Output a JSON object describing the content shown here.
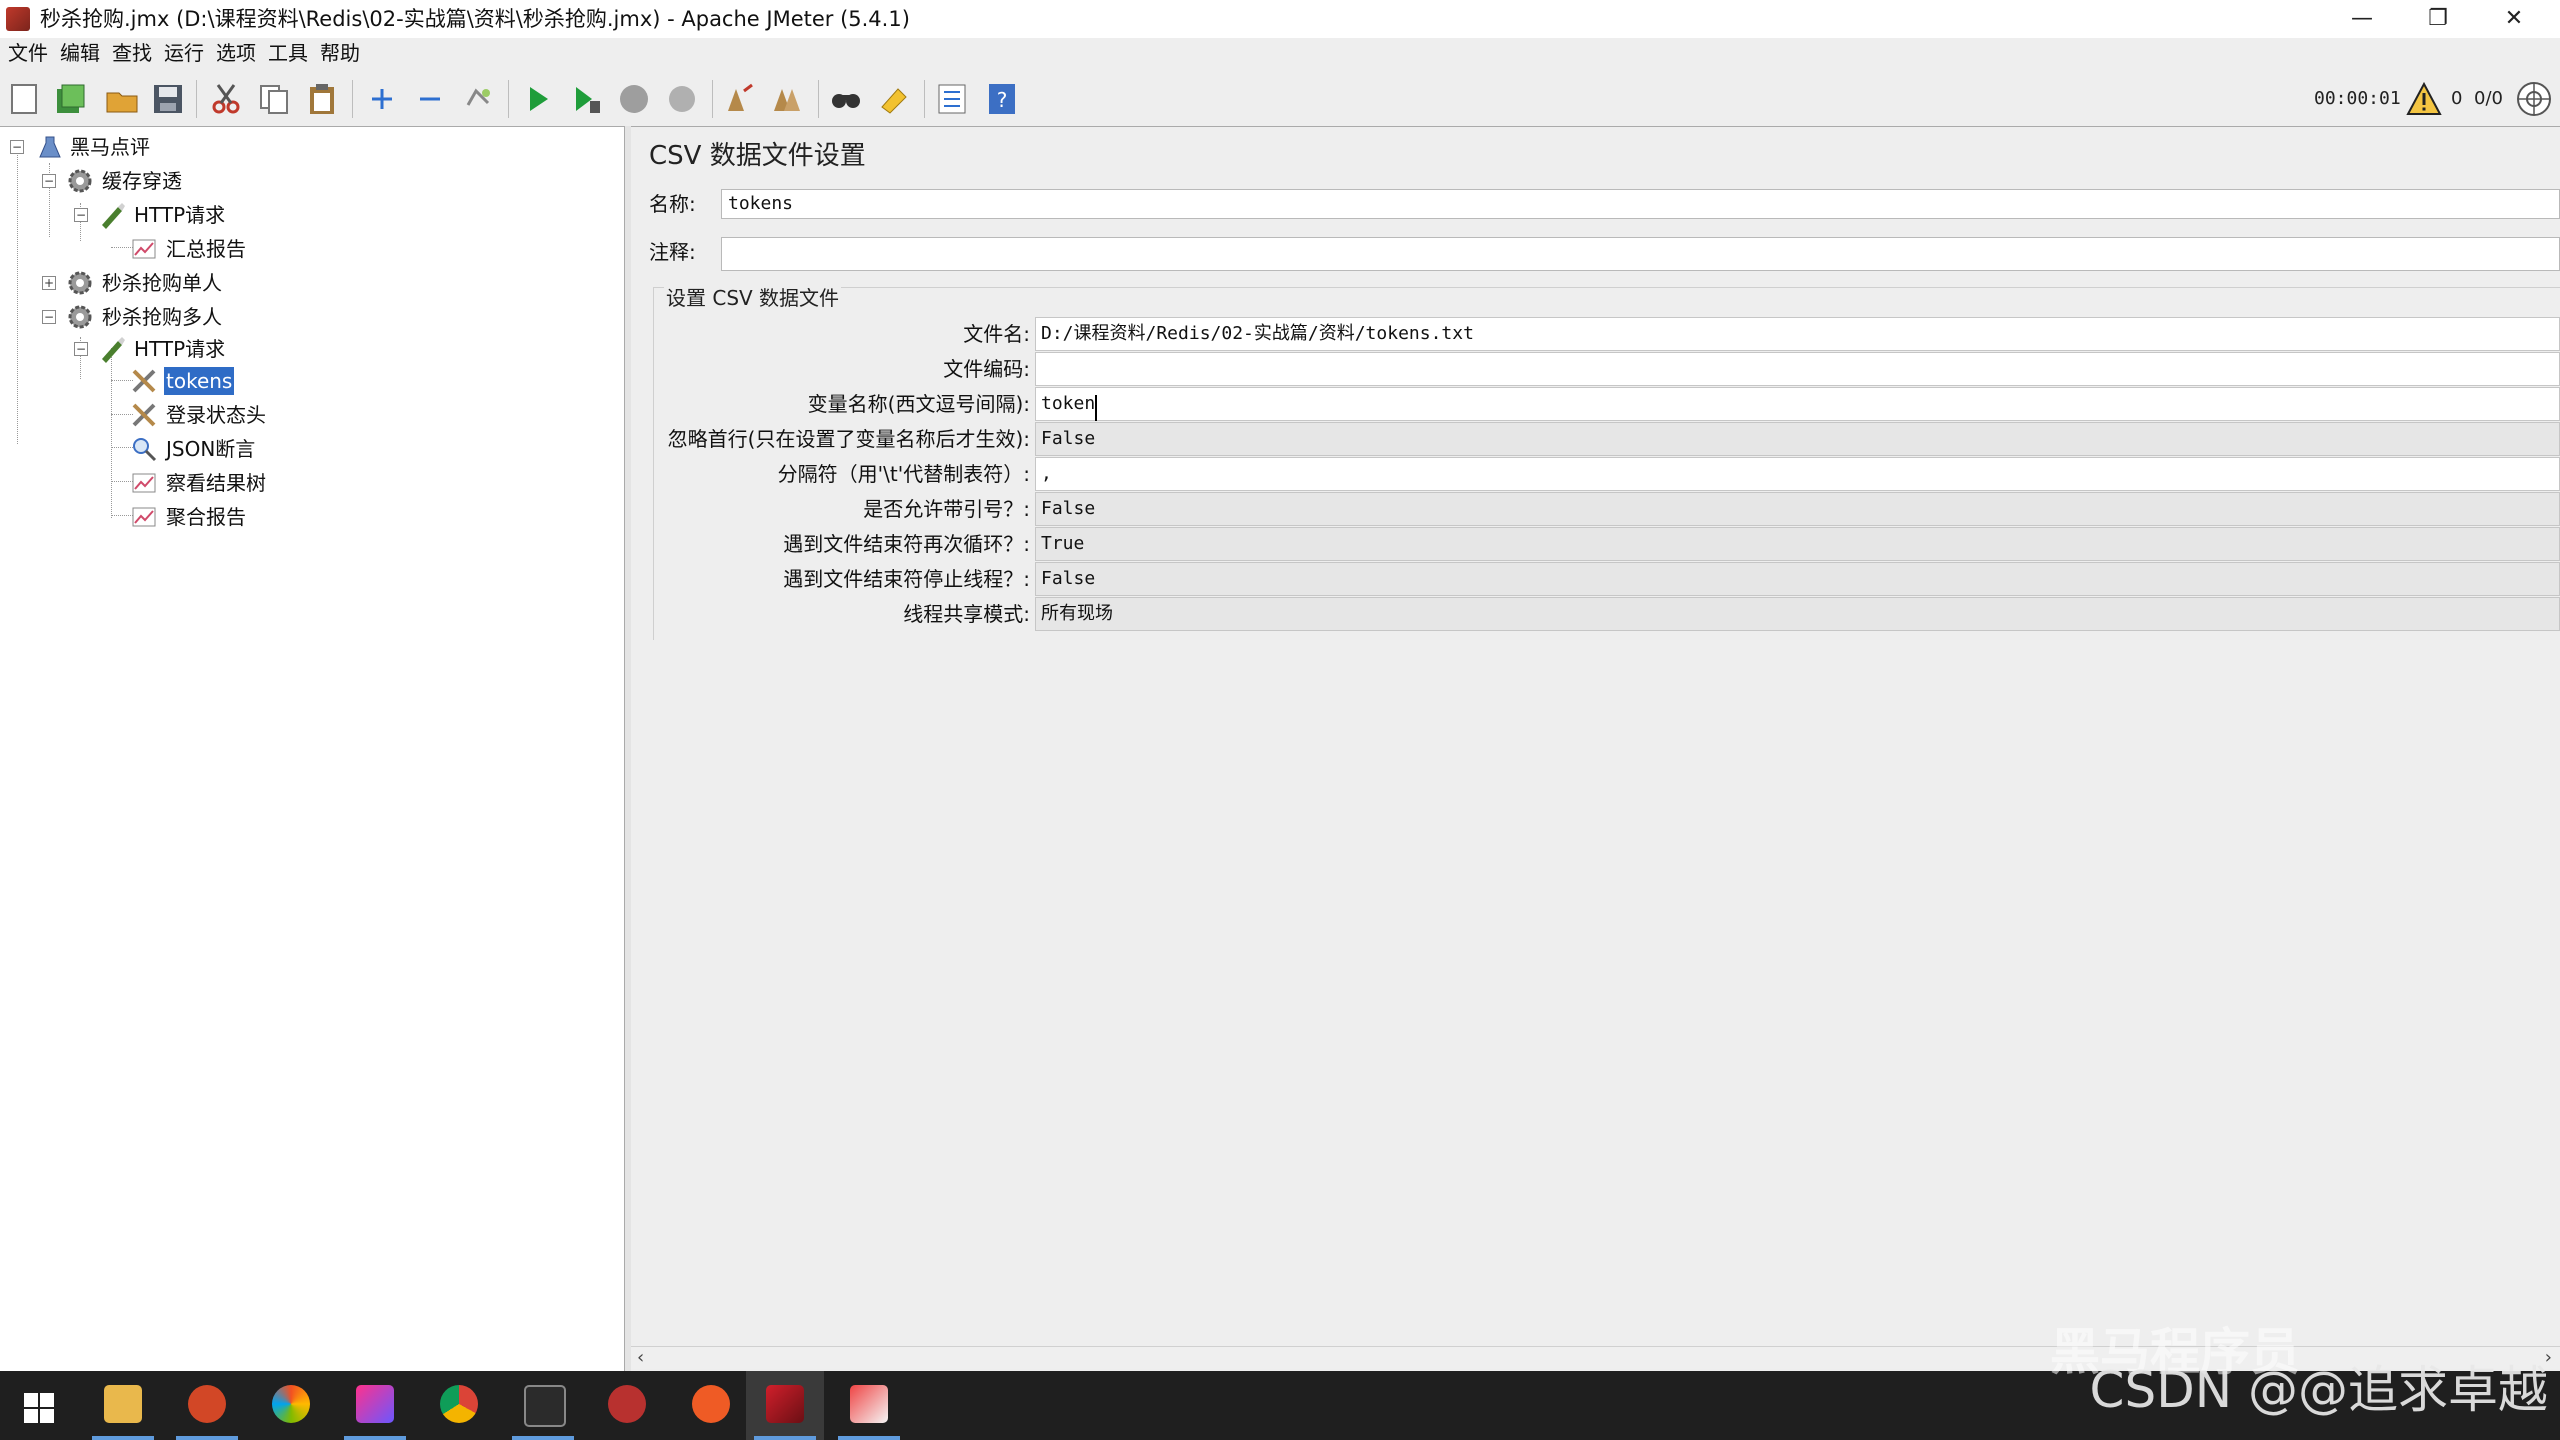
{
  "window": {
    "title": "秒杀抢购.jmx (D:\\课程资料\\Redis\\02-实战篇\\资料\\秒杀抢购.jmx) - Apache JMeter (5.4.1)",
    "minimize": "—",
    "maximize": "❐",
    "close": "✕"
  },
  "menu": [
    "文件",
    "编辑",
    "查找",
    "运行",
    "选项",
    "工具",
    "帮助"
  ],
  "toolbar": {
    "timer": "00:00:01",
    "warnings": "0",
    "threads": "0/0",
    "icons": [
      "new-icon",
      "templates-icon",
      "open-icon",
      "save-icon",
      "cut-icon",
      "copy-icon",
      "paste-icon",
      "expand-icon",
      "collapse-icon",
      "toggle-icon",
      "start-icon",
      "start-no-pause-icon",
      "stop-icon",
      "shutdown-icon",
      "clear-icon",
      "clear-all-icon",
      "search-icon",
      "reset-search-icon",
      "function-helper-icon",
      "help-icon",
      "remote-engines-icon"
    ]
  },
  "tree": {
    "root": "黑马点评",
    "group1": "缓存穿透",
    "group1_http": "HTTP请求",
    "group1_report": "汇总报告",
    "group2": "秒杀抢购单人",
    "group3": "秒杀抢购多人",
    "group3_http": "HTTP请求",
    "tokens": "tokens",
    "header": "登录状态头",
    "json": "JSON断言",
    "results": "察看结果树",
    "aggregate": "聚合报告"
  },
  "panel": {
    "title": "CSV 数据文件设置",
    "name_label": "名称:",
    "name_value": "tokens",
    "comment_label": "注释:",
    "comment_value": "",
    "group_title": "设置 CSV 数据文件",
    "rows": [
      {
        "label": "文件名:",
        "value": "D:/课程资料/Redis/02-实战篇/资料/tokens.txt"
      },
      {
        "label": "文件编码:",
        "value": ""
      },
      {
        "label": "变量名称(西文逗号间隔):",
        "value": "token"
      },
      {
        "label": "忽略首行(只在设置了变量名称后才生效):",
        "value": "False"
      },
      {
        "label": "分隔符（用'\\t'代替制表符）:",
        "value": ","
      },
      {
        "label": "是否允许带引号？:",
        "value": "False"
      },
      {
        "label": "遇到文件结束符再次循环？:",
        "value": "True"
      },
      {
        "label": "遇到文件结束符停止线程？:",
        "value": "False"
      },
      {
        "label": "线程共享模式:",
        "value": "所有现场"
      }
    ]
  },
  "scroll": {
    "left": "‹",
    "right": "›"
  },
  "taskbar": {
    "apps": [
      "windows-start",
      "file-explorer",
      "powerpoint",
      "browser-edge",
      "intellij-idea",
      "chrome",
      "terminal",
      "redis-desktop",
      "postman",
      "jmeter",
      "notes-app"
    ]
  },
  "watermark": "CSDN @@追求卓越",
  "watermark2": "黑马程序员"
}
